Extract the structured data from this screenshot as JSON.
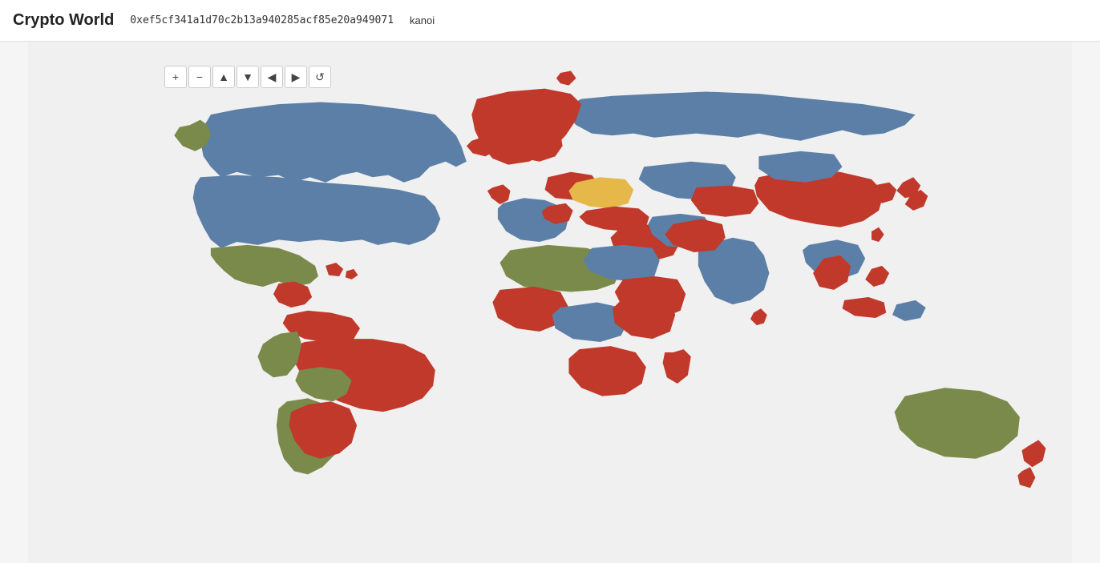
{
  "header": {
    "title": "Crypto World",
    "address": "0xef5cf341a1d70c2b13a940285acf85e20a949071",
    "cursor_label": "kanoi"
  },
  "controls": {
    "zoom_in": "+",
    "zoom_out": "−",
    "pan_up": "▲",
    "pan_down": "▼",
    "pan_left": "◀",
    "pan_right": "▶",
    "reset": "↺"
  },
  "map": {
    "colors": {
      "blue": "#5b7fa6",
      "red": "#c0392b",
      "olive": "#7a8a4a",
      "yellow": "#e6b84a",
      "background": "#f0f0f0"
    }
  }
}
